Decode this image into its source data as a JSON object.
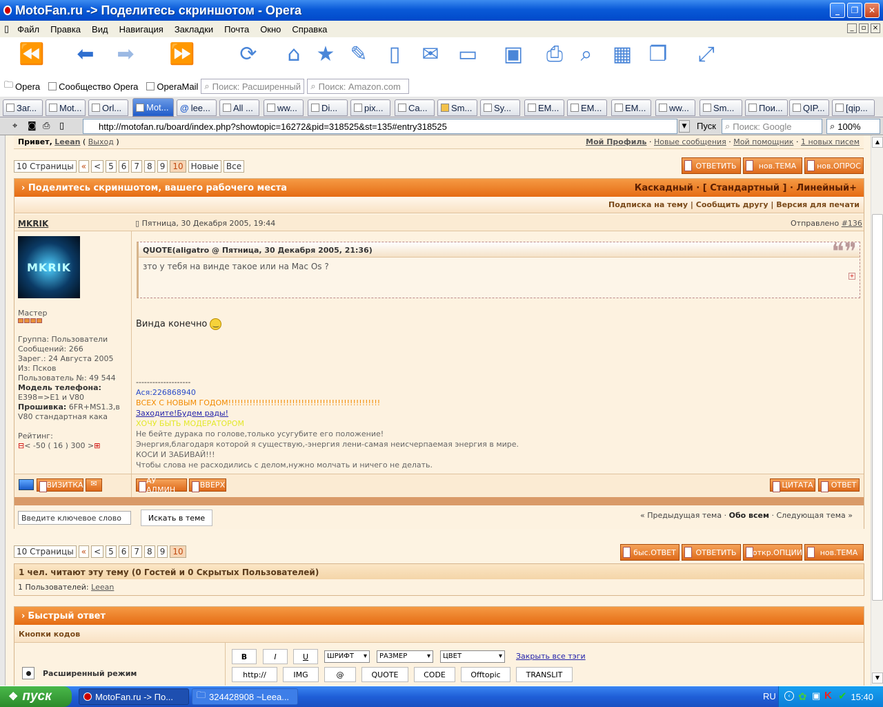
{
  "window": {
    "title": "MotoFan.ru -> Поделитесь скриншотом - Opera"
  },
  "menu": [
    "Файл",
    "Правка",
    "Вид",
    "Навигация",
    "Закладки",
    "Почта",
    "Окно",
    "Справка"
  ],
  "toolbar_icons": [
    "rewind-icon",
    "back-icon",
    "forward-icon",
    "fast-forward-icon",
    "reload-icon",
    "home-icon",
    "bookmark-star-icon",
    "edit-icon",
    "page-icon",
    "mail-icon",
    "folder-icon",
    "save-icon",
    "print-icon",
    "search-icon",
    "windows-icon",
    "copy-icon",
    "fullscreen-icon"
  ],
  "personal_bar": {
    "opera": "Opera",
    "community": "Сообщество Opera",
    "mail": "OperaMail",
    "search1": "Поиск: Расширенный",
    "search2": "Поиск: Amazon.com"
  },
  "tabs": [
    "Заг...",
    "Mot...",
    "Orl...",
    "Mot...",
    "lee...",
    "All ...",
    "ww...",
    "Di...",
    "pix...",
    "Ca...",
    "Sm...",
    "Sy...",
    "EM...",
    "EM...",
    "EM...",
    "ww...",
    "Sm...",
    "Пои...",
    "QIP...",
    "[qip..."
  ],
  "address": {
    "url": "http://motofan.ru/board/index.php?showtopic=16272&pid=318525&st=135#entry318525",
    "go": "Пуск",
    "search_placeholder": "Поиск: Google",
    "zoom": "100%"
  },
  "userbar": {
    "greeting": "Привет,",
    "user": "Leean",
    "logout": "Выход",
    "links": [
      "Мой Профиль",
      "Новые сообщения",
      "Мой помощник",
      "1 новых писем"
    ]
  },
  "pager": {
    "label": "10 Страницы",
    "first": "«",
    "prev": "<",
    "pages": [
      "5",
      "6",
      "7",
      "8",
      "9",
      "10"
    ],
    "new": "Новые",
    "all": "Все"
  },
  "top_buttons": [
    "ОТВЕТИТЬ",
    "нов.ТЕМА",
    "нов.ОПРОС"
  ],
  "topic": {
    "title": "Поделитесь скриншотом, вашего рабочего места",
    "modes": "Каскадный · [ Стандартный ] · Линейный+",
    "actions": [
      "Подписка на тему",
      "Сообщить другу",
      "Версия для печати"
    ]
  },
  "post": {
    "author": "MKRIK",
    "date": "Пятница, 30 Декабря 2005, 19:44",
    "sent_label": "Отправлено",
    "post_no": "#136",
    "avatar_text": "MKRIK",
    "rank": "Мастер",
    "info": [
      "Группа: Пользователи",
      "Сообщений: 266",
      "Зарег.: 24 Августа 2005",
      "Из: Псков",
      "Пользователь №: 49 544"
    ],
    "phone_label": "Модель телефона:",
    "phone": "E398=>E1 и V80",
    "fw_label": "Прошивка:",
    "fw": "6FR+MS1.3,в V80 стандартная кака",
    "rating_label": "Рейтинг:",
    "rating": "< -50 ( 16 ) 300 >",
    "quote_head": "QUOTE(aligatro @ Пятница, 30 Декабря 2005, 21:36)",
    "quote_text": "зто у тебя на винде такое или на Mac Os ?",
    "body": "Винда конечно",
    "sig_dashes": "--------------------",
    "sig_icq": "Ася:226868940",
    "sig_ny": "ВСЕХ С НОВЫМ ГОДОМ!!!!!!!!!!!!!!!!!!!!!!!!!!!!!!!!!!!!!!!!!!!!!!!!!!",
    "sig_link": "Заходите!Будем рады!",
    "sig_mod": "ХОЧУ БЫТЬ МОДЕРАТОРОМ",
    "sig_lines": [
      "Не бейте дурака по голове,только усугубите его положение!",
      "Энергия,благодаря которой я существую,-энергия лени-самая неисчерпаемая энергия в мире.",
      "КОСИ И ЗАБИВАЙ!!!",
      "Чтобы слова не расходились с делом,нужно молчать и ничего не делать."
    ],
    "btn_card": "ВИЗИТКА",
    "btn_admin": "АУ АДМИН",
    "btn_up": "ВВЕРХ",
    "btn_quote": "ЦИТАТА",
    "btn_reply": "ОТВЕТ"
  },
  "search": {
    "placeholder": "Введите ключевое слово",
    "button": "Искать в теме"
  },
  "topic_nav": {
    "prev": "« Предыдущая тема",
    "sep1": "·",
    "all": "Обо всем",
    "sep2": "·",
    "next": "Следующая тема »"
  },
  "bottom_buttons": [
    "быс.ОТВЕТ",
    "ОТВЕТИТЬ",
    "откр.ОПЦИИ",
    "нов.ТЕМА"
  ],
  "readers": {
    "title": "1 чел. читают эту тему (0 Гостей и 0 Скрытых Пользователей)",
    "users_label": "1 Пользователей:",
    "user": "Leean"
  },
  "quick_reply": {
    "title": "Быстрый ответ",
    "codes": "Кнопки кодов",
    "mode": "Расширенный режим",
    "row1": [
      "B",
      "I",
      "U"
    ],
    "font": "ШРИФТ",
    "size": "РАЗМЕР",
    "color": "ЦВЕТ",
    "close_tags": "Закрыть все тэги",
    "row2": [
      "http://",
      "IMG",
      "@",
      "QUOTE",
      "CODE",
      "Offtopic",
      "TRANSLIT"
    ]
  },
  "taskbar": {
    "start": "пуск",
    "task1": "MotoFan.ru -> По...",
    "task2": "324428908 ~Leea...",
    "lang": "RU",
    "time": "15:40"
  }
}
